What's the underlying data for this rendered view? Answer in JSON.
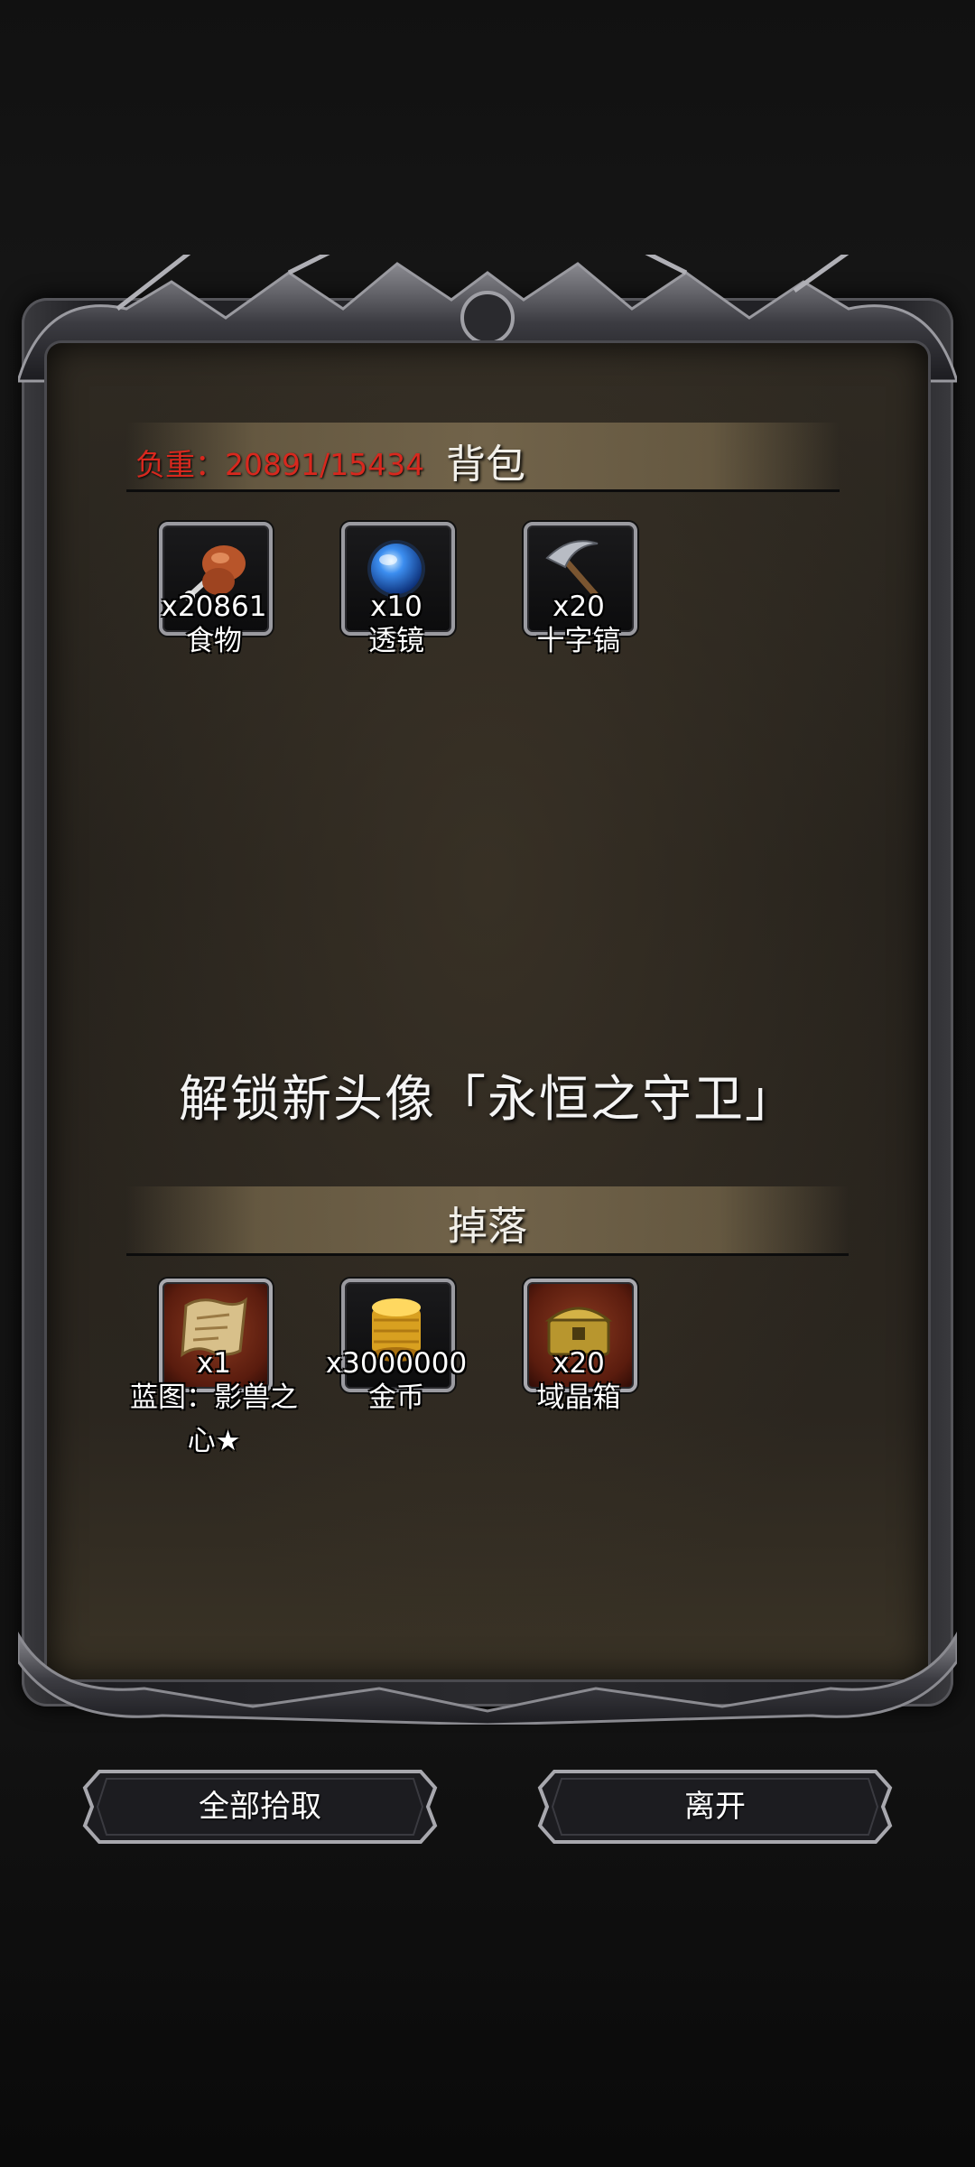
{
  "backpack": {
    "weight_label": "负重：20891/15434",
    "title": "背包",
    "items": [
      {
        "name": "食物",
        "qty": "x20861",
        "icon": "food-icon"
      },
      {
        "name": "透镜",
        "qty": "x10",
        "icon": "lens-icon"
      },
      {
        "name": "十字镐",
        "qty": "x20",
        "icon": "pickaxe-icon"
      }
    ]
  },
  "unlock_message": "解锁新头像「永恒之守卫」",
  "drops": {
    "title": "掉落",
    "items": [
      {
        "name": "蓝图：影兽之心★",
        "qty": "x1",
        "icon": "blueprint-scroll-icon"
      },
      {
        "name": "金币",
        "qty": "x3000000",
        "icon": "gold-coins-icon"
      },
      {
        "name": "域晶箱",
        "qty": "x20",
        "icon": "crystal-chest-icon"
      }
    ]
  },
  "buttons": {
    "pick_all": "全部拾取",
    "leave": "离开"
  },
  "colors": {
    "weight_text": "#d8281e",
    "panel_bg": "#2b261f",
    "header_bar": "#78694e"
  }
}
